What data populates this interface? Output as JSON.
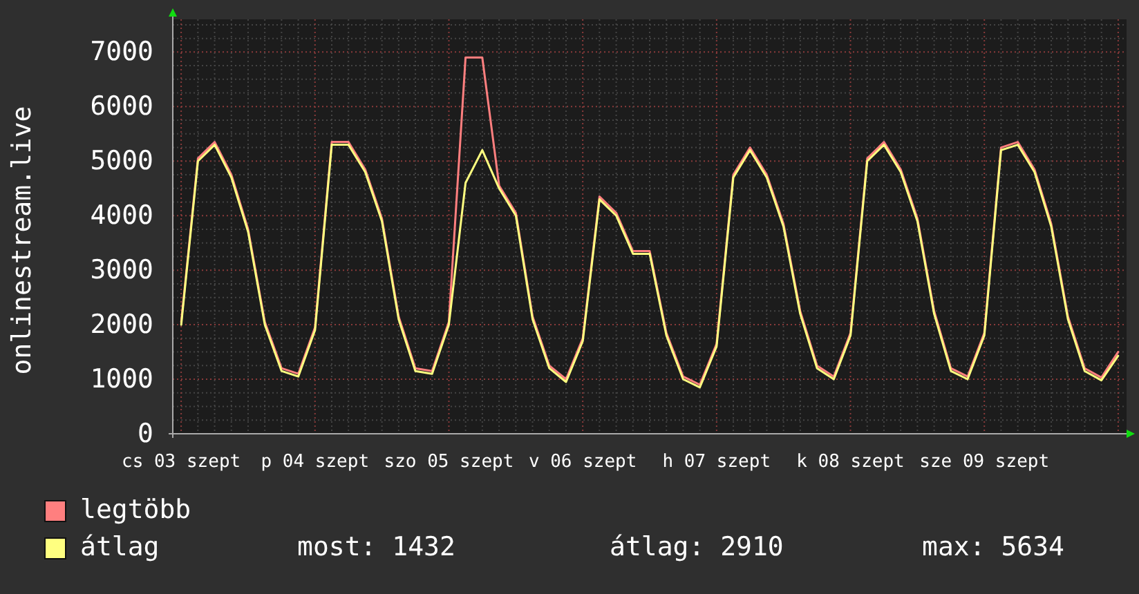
{
  "chart_data": {
    "type": "line",
    "ylabel": "onlinestream.live",
    "categories": [
      "cs 03 szept",
      null,
      null,
      null,
      null,
      null,
      null,
      null,
      "p 04 szept",
      null,
      null,
      null,
      null,
      null,
      null,
      null,
      "szo 05 szept",
      null,
      null,
      null,
      null,
      null,
      null,
      null,
      "v 06 szept",
      null,
      null,
      null,
      null,
      null,
      null,
      null,
      "h 07 szept",
      null,
      null,
      null,
      null,
      null,
      null,
      null,
      "k 08 szept",
      null,
      null,
      null,
      null,
      null,
      null,
      null,
      "sze 09 szept",
      null,
      null,
      null,
      null,
      null,
      null,
      null,
      null
    ],
    "series": [
      {
        "name": "legtöbb",
        "color": "#ff7f7f",
        "values": [
          2050,
          5050,
          5350,
          4750,
          3750,
          2050,
          1200,
          1100,
          1950,
          5350,
          5350,
          4850,
          3950,
          2150,
          1200,
          1150,
          2050,
          6900,
          6900,
          4550,
          4050,
          2150,
          1250,
          1000,
          1750,
          4350,
          4050,
          3350,
          3350,
          1850,
          1050,
          900,
          1650,
          4750,
          5250,
          4750,
          3850,
          2250,
          1250,
          1050,
          1850,
          5050,
          5350,
          4850,
          3950,
          2250,
          1200,
          1050,
          1850,
          5250,
          5350,
          4850,
          3850,
          2150,
          1200,
          1030,
          1500
        ]
      },
      {
        "name": "átlag",
        "color": "#ffff80",
        "values": [
          2000,
          5000,
          5300,
          4700,
          3700,
          2000,
          1150,
          1050,
          1900,
          5300,
          5300,
          4800,
          3900,
          2100,
          1150,
          1100,
          2000,
          4600,
          5200,
          4500,
          4000,
          2100,
          1200,
          950,
          1700,
          4300,
          4000,
          3300,
          3300,
          1800,
          1000,
          850,
          1600,
          4700,
          5200,
          4700,
          3800,
          2200,
          1200,
          1000,
          1800,
          5000,
          5300,
          4800,
          3900,
          2200,
          1150,
          1000,
          1800,
          5200,
          5300,
          4800,
          3800,
          2100,
          1150,
          980,
          1430
        ]
      }
    ],
    "ylim": [
      0,
      7600
    ],
    "grid": true,
    "yticks": [
      0,
      1000,
      2000,
      3000,
      4000,
      5000,
      6000,
      7000
    ]
  },
  "legend_stats": [
    "most: 1432",
    "átlag: 2910",
    "max: 5634"
  ]
}
